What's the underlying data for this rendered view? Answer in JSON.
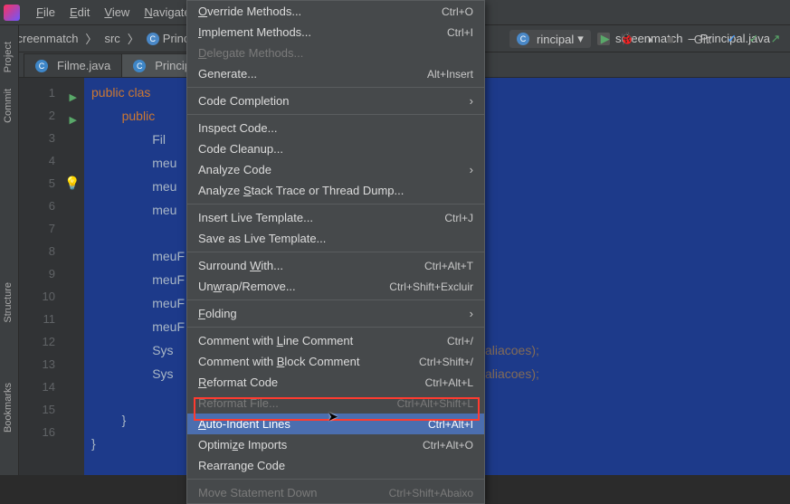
{
  "menubar": {
    "file": "File",
    "edit": "Edit",
    "view": "View",
    "navigate": "Navigate"
  },
  "title": {
    "project": "screenmatch",
    "file": "Principal.java",
    "sep": "–"
  },
  "breadcrumb": {
    "root": "screenmatch",
    "b1": "src",
    "b2": "Principal"
  },
  "run": {
    "config": "rincipal",
    "git": "Git:"
  },
  "tabs": {
    "t0": "Filme.java",
    "t1": "Principal"
  },
  "sidebar": {
    "project": "Project",
    "commit": "Commit",
    "structure": "Structure",
    "bookmarks": "Bookmarks"
  },
  "gutter": {
    "l1": "1",
    "l2": "2",
    "l3": "3",
    "l4": "4",
    "l5": "5",
    "l6": "6",
    "l7": "7",
    "l8": "8",
    "l9": "9",
    "l10": "10",
    "l11": "11",
    "l12": "12",
    "l13": "13",
    "l14": "14",
    "l15": "15",
    "l16": "16"
  },
  "code": {
    "l1a": "public ",
    "l1b": "clas",
    "l2a": "public ",
    "l3": "Fil",
    "l4": "meu",
    "l5": "meu",
    "l6": "meu",
    "l8": "meuF",
    "l9": "meuF",
    "l10": "meuF",
    "l11": "meuF",
    "l12a": "Sys",
    "l12b": "aliacoes);",
    "l13a": "Sys",
    "l13b": "aliacoes);",
    "l15": "}",
    "l16": "}"
  },
  "menu": {
    "override": {
      "label": "Override Methods...",
      "sc": "Ctrl+O"
    },
    "implement": {
      "label": "Implement Methods...",
      "sc": "Ctrl+I"
    },
    "delegate": {
      "label": "Delegate Methods..."
    },
    "generate": {
      "label": "Generate...",
      "sc": "Alt+Insert"
    },
    "completion": {
      "label": "Code Completion"
    },
    "inspect": {
      "label": "Inspect Code..."
    },
    "cleanup": {
      "label": "Code Cleanup..."
    },
    "analyzecode": {
      "label": "Analyze Code"
    },
    "analyzestk": {
      "label": "Analyze Stack Trace or Thread Dump..."
    },
    "insertlt": {
      "label": "Insert Live Template...",
      "sc": "Ctrl+J"
    },
    "savelt": {
      "label": "Save as Live Template..."
    },
    "surround": {
      "label": "Surround With...",
      "sc": "Ctrl+Alt+T"
    },
    "unwrap": {
      "label": "Unwrap/Remove...",
      "sc": "Ctrl+Shift+Excluir"
    },
    "folding": {
      "label": "Folding"
    },
    "cmtline": {
      "label": "Comment with Line Comment",
      "sc": "Ctrl+/"
    },
    "cmtblock": {
      "label": "Comment with Block Comment",
      "sc": "Ctrl+Shift+/"
    },
    "reformat": {
      "label": "Reformat Code",
      "sc": "Ctrl+Alt+L"
    },
    "reformatfile": {
      "label": "Reformat File...",
      "sc": "Ctrl+Alt+Shift+L"
    },
    "autoindent": {
      "label": "Auto-Indent Lines",
      "sc": "Ctrl+Alt+I"
    },
    "optimize": {
      "label": "Optimize Imports",
      "sc": "Ctrl+Alt+O"
    },
    "rearrange": {
      "label": "Rearrange Code"
    },
    "movedn": {
      "label": "Move Statement Down",
      "sc": "Ctrl+Shift+Abaixo"
    }
  }
}
